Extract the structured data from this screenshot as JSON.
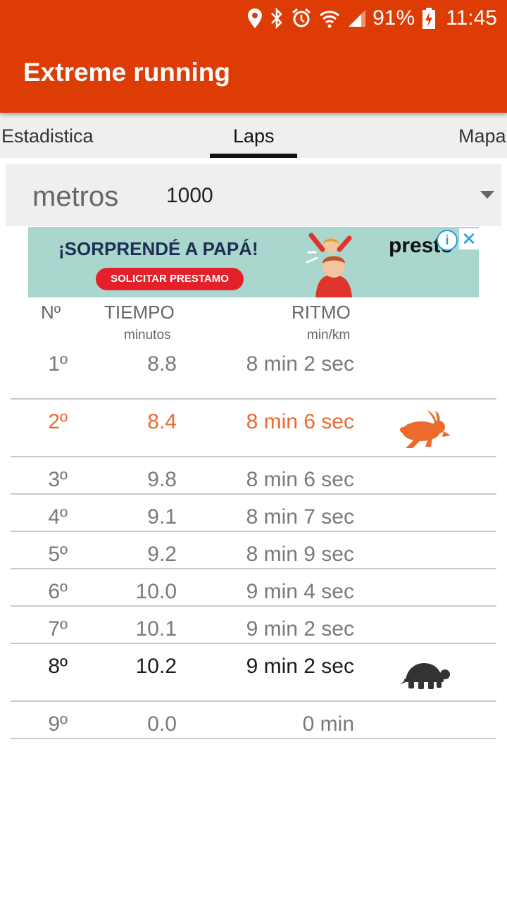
{
  "status_bar": {
    "battery": "91%",
    "time": "11:45",
    "icons": [
      "location-icon",
      "bluetooth-icon",
      "alarm-icon",
      "wifi-icon",
      "signal-icon",
      "battery-charging-icon"
    ]
  },
  "app": {
    "title": "Extreme running"
  },
  "tabs": [
    {
      "label": "Estadistica",
      "active": false
    },
    {
      "label": "Laps",
      "active": true
    },
    {
      "label": "Mapa",
      "active": false
    }
  ],
  "distance_selector": {
    "label": "metros",
    "value": "1000",
    "icon": "dropdown-arrow-icon"
  },
  "ad": {
    "headline": "¡SORPRENDÉ A PAPÁ!",
    "cta": "SOLICITAR PRESTAMO",
    "brand": "presto",
    "info_icon": "ad-info-icon",
    "close_icon": "ad-close-icon"
  },
  "table": {
    "headers": {
      "num": "Nº",
      "time": "TIEMPO",
      "time_unit": "minutos",
      "pace": "RITMO",
      "pace_unit": "min/km"
    },
    "rows": [
      {
        "num": "1º",
        "time": "8.8",
        "pace": "8 min 2 sec",
        "highlight": "none"
      },
      {
        "num": "2º",
        "time": "8.4",
        "pace": "8 min 6 sec",
        "highlight": "fastest",
        "icon": "rabbit-icon"
      },
      {
        "num": "3º",
        "time": "9.8",
        "pace": "8 min 6 sec",
        "highlight": "none"
      },
      {
        "num": "4º",
        "time": "9.1",
        "pace": "8 min 7 sec",
        "highlight": "none"
      },
      {
        "num": "5º",
        "time": "9.2",
        "pace": "8 min 9 sec",
        "highlight": "none"
      },
      {
        "num": "6º",
        "time": "10.0",
        "pace": "9 min 4 sec",
        "highlight": "none"
      },
      {
        "num": "7º",
        "time": "10.1",
        "pace": "9 min 2 sec",
        "highlight": "none"
      },
      {
        "num": "8º",
        "time": "10.2",
        "pace": "9 min 2 sec",
        "highlight": "slowest",
        "icon": "turtle-icon"
      },
      {
        "num": "9º",
        "time": "0.0",
        "pace": "0 min",
        "highlight": "none"
      }
    ]
  },
  "colors": {
    "primary": "#de3c05",
    "fastest_text": "#ec6a2c",
    "slowest_text": "#1a1a1a",
    "normal_text": "#7a7a7a",
    "divider": "#c9c9c9",
    "tab_bar": "#efefef"
  }
}
